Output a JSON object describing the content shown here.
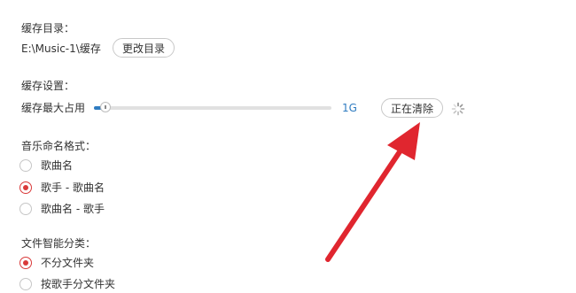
{
  "cache_dir": {
    "title": "缓存目录：",
    "path": "E:\\Music-1\\缓存",
    "change_label": "更改目录"
  },
  "cache_settings": {
    "title": "缓存设置：",
    "max_label": "缓存最大占用",
    "max_value": "1G",
    "slider_fraction": 0.05,
    "clear_label": "正在清除",
    "loading_icon": "spinner-icon",
    "accent_color": "#2f7cc1"
  },
  "naming": {
    "title": "音乐命名格式：",
    "options": [
      "歌曲名",
      "歌手 - 歌曲名",
      "歌曲名 - 歌手"
    ],
    "selected_index": 1,
    "radio_color": "#d93a3a"
  },
  "classify": {
    "title": "文件智能分类：",
    "options": [
      "不分文件夹",
      "按歌手分文件夹"
    ],
    "selected_index": 0
  },
  "annotation": {
    "arrow_color": "#e0262f"
  }
}
